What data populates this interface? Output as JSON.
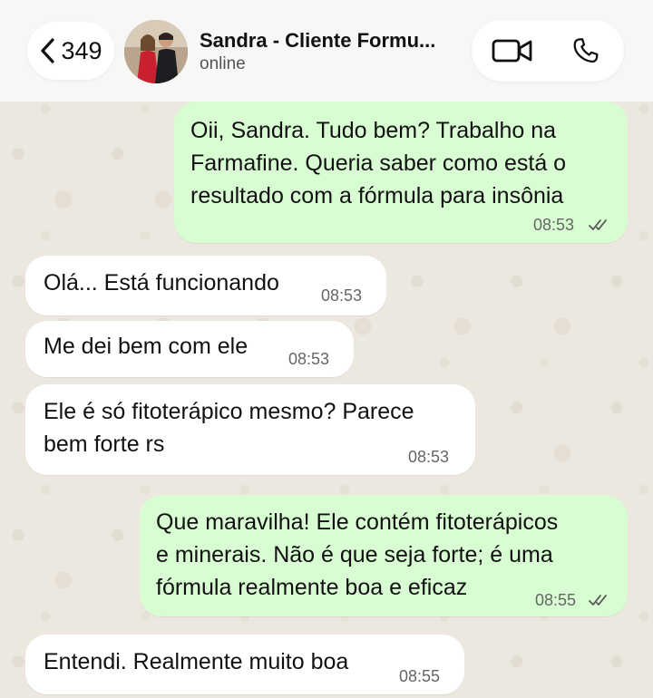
{
  "header": {
    "back_count": "349",
    "contact_name": "Sandra - Cliente Formu...",
    "status": "online",
    "icons": {
      "back": "chevron-left-icon",
      "video": "video-camera-icon",
      "phone": "phone-icon"
    }
  },
  "messages": [
    {
      "direction": "outgoing",
      "text": "Oii, Sandra. Tudo bem? Trabalho na\nFarmafine. Queria saber como está o\nresultado com a fórmula para insônia",
      "time": "08:53",
      "status": "read"
    },
    {
      "direction": "incoming",
      "text": "Olá... Está funcionando",
      "time": "08:53"
    },
    {
      "direction": "incoming",
      "text": "Me dei bem com ele",
      "time": "08:53"
    },
    {
      "direction": "incoming",
      "text": "Ele é só fitoterápico mesmo? Parece\nbem forte rs",
      "time": "08:53"
    },
    {
      "direction": "outgoing",
      "text": "Que maravilha! Ele contém fitoterápicos\ne minerais. Não é que seja forte; é uma\nfórmula realmente boa e eficaz",
      "time": "08:55",
      "status": "read"
    },
    {
      "direction": "incoming",
      "text": "Entendi. Realmente muito boa",
      "time": "08:55"
    }
  ],
  "colors": {
    "outgoing_bubble": "#d9fdd3",
    "incoming_bubble": "#ffffff",
    "chat_background": "#ece8df"
  }
}
